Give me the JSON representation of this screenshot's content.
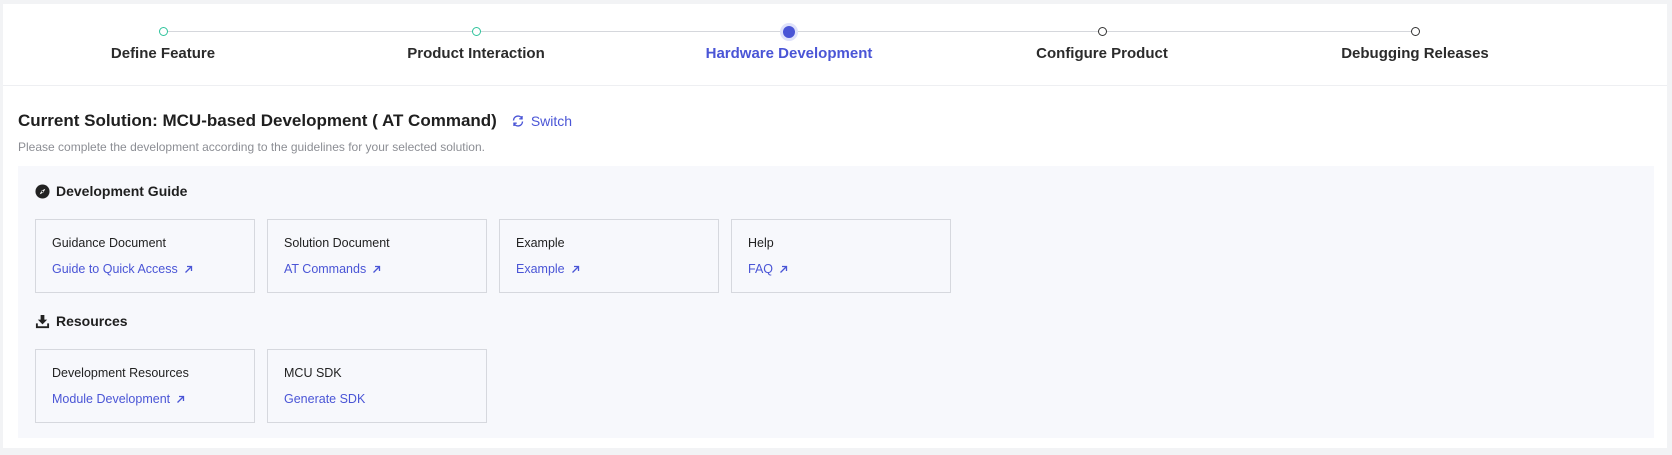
{
  "stepper": {
    "steps": [
      {
        "label": "Define Feature",
        "state": "done"
      },
      {
        "label": "Product Interaction",
        "state": "done"
      },
      {
        "label": "Hardware Development",
        "state": "active"
      },
      {
        "label": "Configure Product",
        "state": "todo"
      },
      {
        "label": "Debugging Releases",
        "state": "todo"
      }
    ]
  },
  "header": {
    "title": "Current Solution: MCU-based Development ( AT Command)",
    "switch_label": "Switch",
    "subtitle": "Please complete the development according to the guidelines for your selected solution."
  },
  "development_guide": {
    "heading": "Development Guide",
    "icon": "compass-icon",
    "cards": [
      {
        "title": "Guidance Document",
        "link": "Guide to Quick Access",
        "external": true
      },
      {
        "title": "Solution Document",
        "link": "AT Commands",
        "external": true
      },
      {
        "title": "Example",
        "link": "Example",
        "external": true
      },
      {
        "title": "Help",
        "link": "FAQ",
        "external": true
      }
    ]
  },
  "resources": {
    "heading": "Resources",
    "icon": "download-icon",
    "cards": [
      {
        "title": "Development Resources",
        "link": "Module Development",
        "external": true
      },
      {
        "title": "MCU SDK",
        "link": "Generate SDK",
        "external": false
      }
    ]
  },
  "colors": {
    "accent": "#4a55d6",
    "done": "#2fc39c",
    "panel_bg": "#f7f8fc"
  }
}
